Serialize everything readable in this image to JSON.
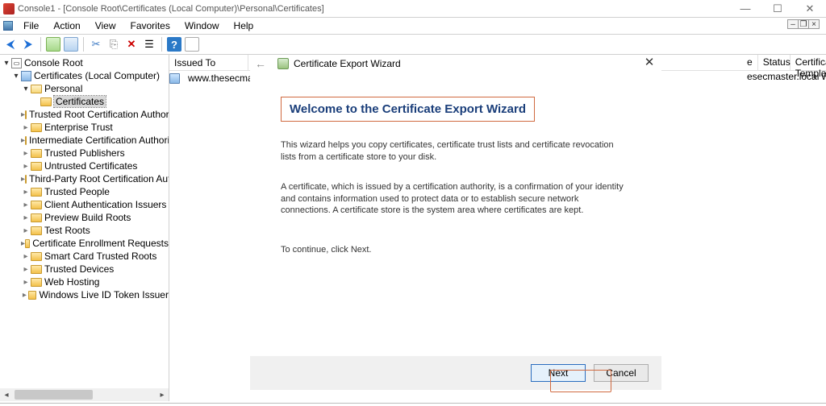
{
  "titlebar": {
    "text": "Console1 - [Console Root\\Certificates (Local Computer)\\Personal\\Certificates]"
  },
  "menus": [
    "File",
    "Action",
    "View",
    "Favorites",
    "Window",
    "Help"
  ],
  "tree": {
    "root": "Console Root",
    "certs": "Certificates (Local Computer)",
    "personal": "Personal",
    "certificates": "Certificates",
    "items": [
      "Trusted Root Certification Authorities",
      "Enterprise Trust",
      "Intermediate Certification Authorities",
      "Trusted Publishers",
      "Untrusted Certificates",
      "Third-Party Root Certification Authoritie",
      "Trusted People",
      "Client Authentication Issuers",
      "Preview Build Roots",
      "Test Roots",
      "Certificate Enrollment Requests",
      "Smart Card Trusted Roots",
      "Trusted Devices",
      "Web Hosting",
      "Windows Live ID Token Issuer"
    ]
  },
  "list": {
    "col_issued_to": "Issued To",
    "row_issued_to": "www.thesecmaster.l",
    "col_e": "e",
    "col_status": "Status",
    "col_template": "Certificate Template",
    "row_e": "esecmaster.local",
    "row_template": "WebServer"
  },
  "wizard": {
    "breadcrumb": "Certificate Export Wizard",
    "title": "Welcome to the Certificate Export Wizard",
    "p1": "This wizard helps you copy certificates, certificate trust lists and certificate revocation lists from a certificate store to your disk.",
    "p2": "A certificate, which is issued by a certification authority, is a confirmation of your identity and contains information used to protect data or to establish secure network connections. A certificate store is the system area where certificates are kept.",
    "p3": "To continue, click Next.",
    "next": "Next",
    "cancel": "Cancel"
  }
}
